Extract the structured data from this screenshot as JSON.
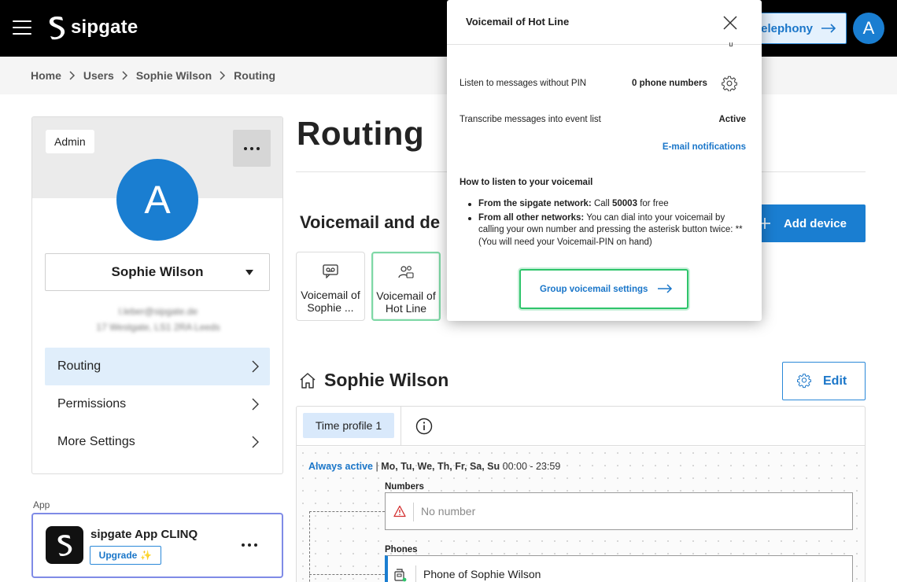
{
  "header": {
    "brand": "sipgate",
    "telephony_label": "elephony",
    "avatar_initial": "A"
  },
  "breadcrumb": [
    "Home",
    "Users",
    "Sophie Wilson",
    "Routing"
  ],
  "user_card": {
    "role_badge": "Admin",
    "avatar_initial": "A",
    "selected_user": "Sophie Wilson",
    "email_blurred": "l.leber@sipgate.de",
    "address_blurred": "17 Westgate, LS1 2RA Leeds",
    "nav": [
      {
        "label": "Routing",
        "active": true
      },
      {
        "label": "Permissions",
        "active": false
      },
      {
        "label": "More Settings",
        "active": false
      }
    ]
  },
  "app_section": {
    "label": "App",
    "name": "sipgate App CLINQ",
    "upgrade_label": "Upgrade",
    "upgrade_emoji": "✨"
  },
  "main": {
    "title": "Routing",
    "section_title": "Voicemail and de",
    "add_device_label": "Add device",
    "voicemail_tiles": [
      {
        "label": "Voicemail of Sophie ...",
        "icon": "voicemail-icon",
        "selected": false
      },
      {
        "label": "Voicemail of Hot Line",
        "icon": "group-voicemail-icon",
        "selected": true
      }
    ],
    "user_heading": "Sophie Wilson",
    "edit_label": "Edit",
    "time_profile_tab": "Time profile 1",
    "always_active": "Always active",
    "schedule_days": "Mo, Tu, We, Th, Fr, Sa, Su",
    "schedule_time": "00:00 - 23:59",
    "numbers_label": "Numbers",
    "numbers_placeholder": "No number",
    "phones_label": "Phones",
    "phone_value": "Phone of Sophie Wilson"
  },
  "popup": {
    "title": "Voicemail of Hot Line",
    "listen_label": "Listen to messages without PIN",
    "listen_value": "0 phone numbers",
    "transcribe_label": "Transcribe messages into event list",
    "transcribe_value": "Active",
    "email_link": "E-mail notifications",
    "how_title": "How to listen to your voicemail",
    "how_sipgate_bold": "From the sipgate network:",
    "how_sipgate_pre": "Call",
    "how_sipgate_number": "50003",
    "how_sipgate_post": "for free",
    "how_other_bold": "From all other networks:",
    "how_other_text": "You can dial into your voicemail by calling your own number and pressing the asterisk button twice: ** (You will need your Voicemail-PIN on hand)",
    "group_settings_label": "Group voicemail settings"
  },
  "colors": {
    "brand_blue": "#1a7ed1",
    "link_blue": "#1a76c9",
    "focus_green": "#2ec46b",
    "warning_red": "#d32f2f"
  }
}
